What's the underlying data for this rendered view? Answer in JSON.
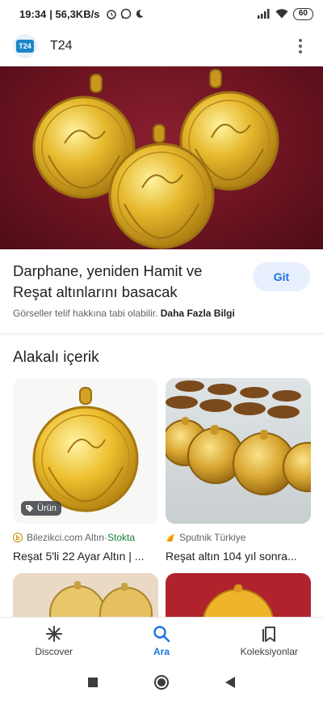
{
  "status_bar": {
    "time": "19:34",
    "network_speed": "| 56,3KB/s",
    "battery": "60",
    "icons": [
      "alarm-icon",
      "whatsapp-icon",
      "moon-icon",
      "signal-icon",
      "wifi-icon",
      "battery-icon"
    ]
  },
  "header": {
    "logo_text": "T24",
    "site_title": "T24",
    "menu_icon": "more-vert-icon"
  },
  "article": {
    "title": "Darphane, yeniden Hamit ve Reşat altınlarını basacak",
    "visit_button": "Git",
    "notice": "Görseller telif hakkına tabi olabilir.",
    "more_info_link": "Daha Fazla Bilgi"
  },
  "related": {
    "heading": "Alakalı içerik",
    "cards": [
      {
        "badge": "Ürün",
        "source": "Bilezikci.com Altın",
        "source_sep": " · ",
        "stock": "Stokta",
        "caption": "Reşat 5'li 22 Ayar Altın   |   ..."
      },
      {
        "source": "Sputnik Türkiye",
        "caption": "Reşat altın 104 yıl sonra..."
      }
    ]
  },
  "bottom_nav": {
    "items": [
      {
        "label": "Discover",
        "icon": "asterisk-icon"
      },
      {
        "label": "Ara",
        "icon": "search-icon"
      },
      {
        "label": "Koleksiyonlar",
        "icon": "bookmarks-icon"
      }
    ],
    "active": "Ara"
  },
  "colors": {
    "accent": "#1a73e8",
    "button_bg": "#e8f0fe",
    "stock_green": "#188038",
    "hero_bg": "#6d1421"
  }
}
